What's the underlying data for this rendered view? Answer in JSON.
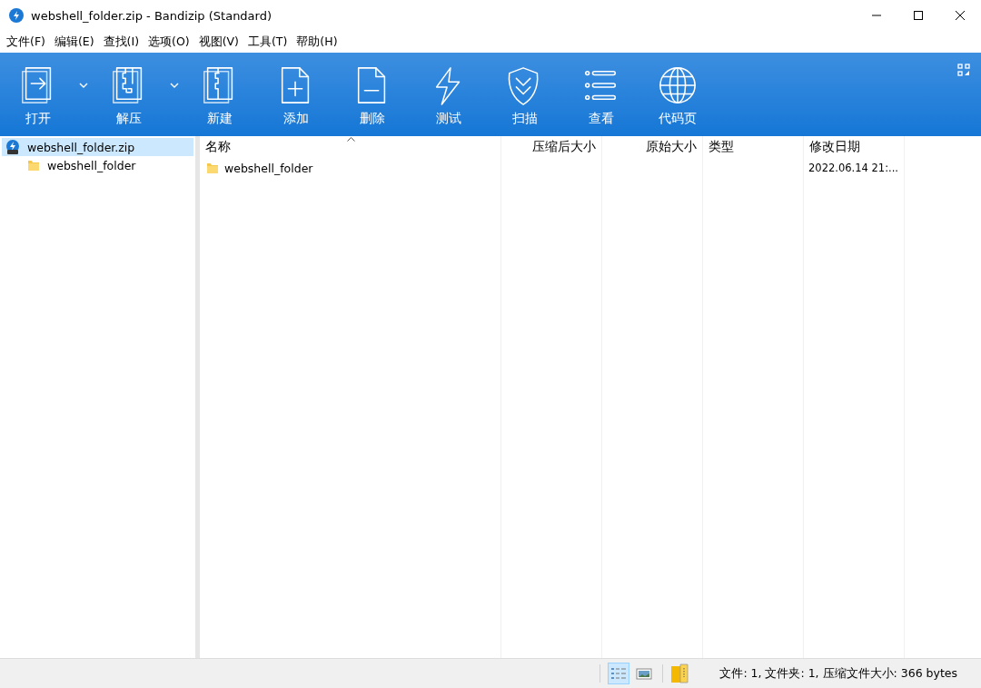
{
  "window": {
    "title": "webshell_folder.zip - Bandizip (Standard)"
  },
  "menu": [
    "文件(F)",
    "编辑(E)",
    "查找(I)",
    "选项(O)",
    "视图(V)",
    "工具(T)",
    "帮助(H)"
  ],
  "toolbar": [
    {
      "kind": "open",
      "label": "打开",
      "dropdown": true
    },
    {
      "kind": "extract",
      "label": "解压",
      "dropdown": true
    },
    {
      "kind": "new",
      "label": "新建",
      "dropdown": false
    },
    {
      "kind": "add",
      "label": "添加",
      "dropdown": false
    },
    {
      "kind": "delete",
      "label": "删除",
      "dropdown": false
    },
    {
      "kind": "test",
      "label": "测试",
      "dropdown": false
    },
    {
      "kind": "scan",
      "label": "扫描",
      "dropdown": false
    },
    {
      "kind": "view",
      "label": "查看",
      "dropdown": false
    },
    {
      "kind": "codepage",
      "label": "代码页",
      "dropdown": false
    }
  ],
  "tree": [
    {
      "kind": "archive",
      "label": "webshell_folder.zip",
      "selected": true,
      "children": [
        {
          "kind": "folder",
          "label": "webshell_folder",
          "selected": false
        }
      ]
    }
  ],
  "columns": [
    {
      "label": "名称",
      "kind": "text",
      "sorted": true
    },
    {
      "label": "压缩后大小",
      "kind": "number",
      "sorted": false
    },
    {
      "label": "原始大小",
      "kind": "number",
      "sorted": false
    },
    {
      "label": "类型",
      "kind": "text",
      "sorted": false
    },
    {
      "label": "修改日期",
      "kind": "text",
      "sorted": false
    }
  ],
  "rows": [
    {
      "kind": "folder",
      "selected": false,
      "cells": [
        "webshell_folder",
        "",
        "",
        "",
        "2022.06.14 21:..."
      ]
    }
  ],
  "status_bar": {
    "view_modes": [
      {
        "kind": "details",
        "selected": true
      },
      {
        "kind": "thumbnails",
        "selected": false
      }
    ],
    "text": "文件: 1, 文件夹: 1, 压缩文件大小: 366 bytes"
  }
}
